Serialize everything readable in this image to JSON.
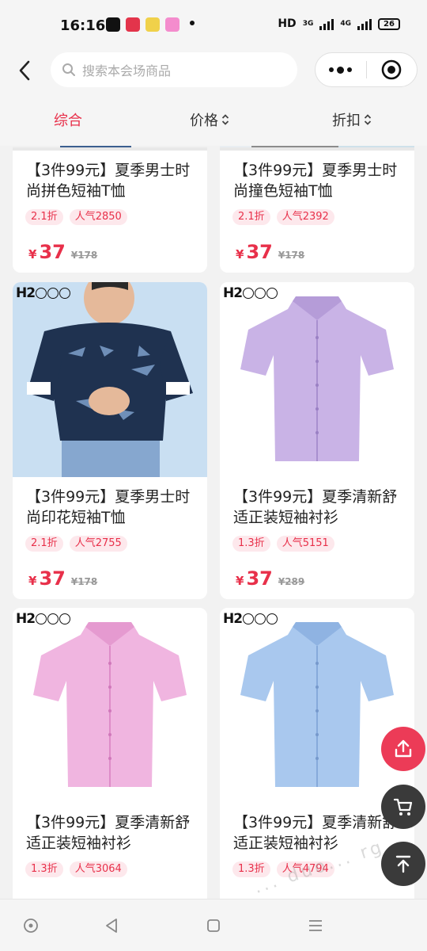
{
  "status_bar": {
    "time": "16:16",
    "network_label": "HD",
    "signal_1": "3G",
    "signal_2": "4G",
    "battery": "26"
  },
  "header": {
    "search_placeholder": "搜索本会场商品"
  },
  "tabs": [
    {
      "label": "综合",
      "active": true
    },
    {
      "label": "价格",
      "active": false
    },
    {
      "label": "折扣",
      "active": false
    }
  ],
  "products": [
    {
      "title": "【3件99元】夏季男士时尚拼色短袖T恤",
      "discount": "2.1折",
      "popularity": "人气2850",
      "currency": "¥",
      "price": "37",
      "original_price": "¥178"
    },
    {
      "title": "【3件99元】夏季男士时尚撞色短袖T恤",
      "discount": "2.1折",
      "popularity": "人气2392",
      "currency": "¥",
      "price": "37",
      "original_price": "¥178"
    },
    {
      "title": "【3件99元】夏季男士时尚印花短袖T恤",
      "discount": "2.1折",
      "popularity": "人气2755",
      "currency": "¥",
      "price": "37",
      "original_price": "¥178",
      "brand": "H2"
    },
    {
      "title": "【3件99元】夏季清新舒适正装短袖衬衫",
      "discount": "1.3折",
      "popularity": "人气5151",
      "currency": "¥",
      "price": "37",
      "original_price": "¥289",
      "brand": "H2"
    },
    {
      "title": "【3件99元】夏季清新舒适正装短袖衬衫",
      "discount": "1.3折",
      "popularity": "人气3064",
      "brand": "H2"
    },
    {
      "title": "【3件99元】夏季清新舒适正装短袖衬衫",
      "discount": "1.3折",
      "popularity": "人气4794",
      "brand": "H2"
    }
  ],
  "colors": {
    "accent": "#e8304a",
    "tag_bg": "#fde8ec",
    "lavender_shirt": "#c9b3e6",
    "pink_shirt": "#f0b5e0",
    "blue_shirt": "#a9c8ee"
  },
  "floating_buttons": [
    "share-icon",
    "cart-icon",
    "back-to-top-icon"
  ],
  "watermark": "... duo... rg"
}
